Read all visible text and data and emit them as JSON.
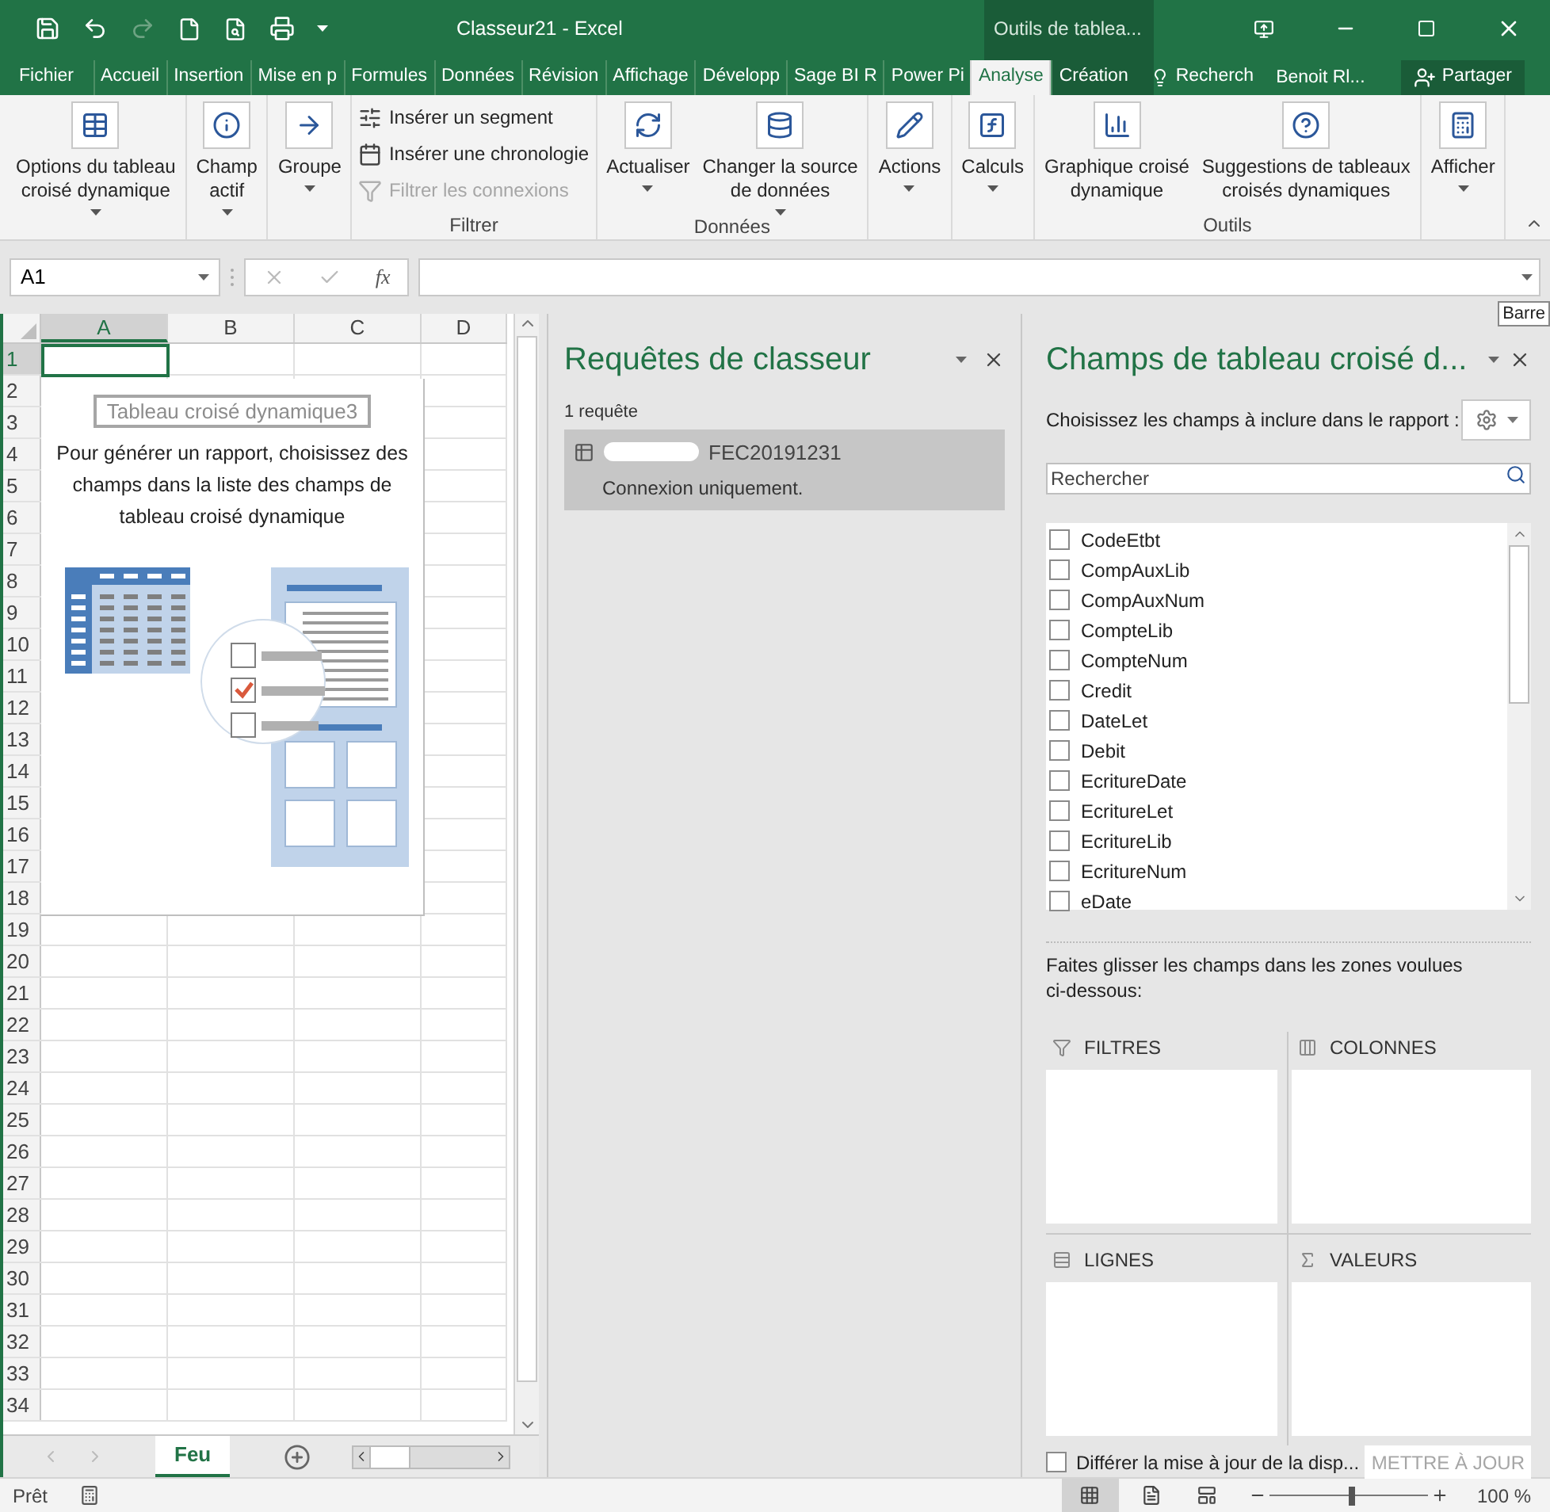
{
  "window": {
    "title": "Classeur21 - Excel",
    "contextual_tab_group": "Outils de tablea..."
  },
  "ribbon_tabs": [
    {
      "label": "Fichier",
      "selected": false
    },
    {
      "label": "Accueil",
      "selected": false
    },
    {
      "label": "Insertion",
      "selected": false
    },
    {
      "label": "Mise en p",
      "selected": false
    },
    {
      "label": "Formules",
      "selected": false
    },
    {
      "label": "Données",
      "selected": false
    },
    {
      "label": "Révision",
      "selected": false
    },
    {
      "label": "Affichage",
      "selected": false
    },
    {
      "label": "Développ",
      "selected": false
    },
    {
      "label": "Sage BI R",
      "selected": false
    },
    {
      "label": "Power Pi",
      "selected": false
    },
    {
      "label": "Analyse",
      "selected": true
    },
    {
      "label": "Création",
      "selected": false
    }
  ],
  "tell_me": "Recherch",
  "user": "Benoit Rl...",
  "share_button": "Partager",
  "ribbon_groups": [
    {
      "buttons": [
        {
          "kind": "large",
          "label": "Options du tableau\ncroisé dynamique",
          "dropdown": true,
          "disabled": false
        }
      ]
    },
    {
      "buttons": [
        {
          "kind": "large",
          "label": "Champ\nactif",
          "dropdown": true,
          "disabled": false
        }
      ]
    },
    {
      "buttons": [
        {
          "kind": "large",
          "label": "Groupe",
          "dropdown": true,
          "disabled": false
        }
      ]
    },
    {
      "label": "Filtrer",
      "buttons": [
        {
          "kind": "small",
          "label": "Insérer un segment",
          "dropdown": false,
          "disabled": false
        },
        {
          "kind": "small",
          "label": "Insérer une chronologie",
          "dropdown": false,
          "disabled": false
        },
        {
          "kind": "small",
          "label": "Filtrer les connexions",
          "dropdown": false,
          "disabled": true
        }
      ]
    },
    {
      "label": "Données",
      "buttons": [
        {
          "kind": "large",
          "label": "Actualiser",
          "dropdown": true,
          "disabled": false
        },
        {
          "kind": "large",
          "label": "Changer la source\nde données",
          "dropdown": true,
          "disabled": false
        }
      ]
    },
    {
      "buttons": [
        {
          "kind": "large",
          "label": "Actions",
          "dropdown": true,
          "disabled": false
        }
      ]
    },
    {
      "buttons": [
        {
          "kind": "large",
          "label": "Calculs",
          "dropdown": true,
          "disabled": false
        }
      ]
    },
    {
      "label": "Outils",
      "buttons": [
        {
          "kind": "large",
          "label": "Graphique croisé\ndynamique",
          "dropdown": false,
          "disabled": false
        },
        {
          "kind": "large",
          "label": "Suggestions de tableaux\ncroisés dynamiques",
          "dropdown": false,
          "disabled": false
        }
      ]
    },
    {
      "buttons": [
        {
          "kind": "large",
          "label": "Afficher",
          "dropdown": true,
          "disabled": false
        }
      ]
    }
  ],
  "name_box": "A1",
  "function_button": "fx",
  "tooltip": "Barre",
  "sheet": {
    "columns": [
      {
        "label": "A",
        "selected": true
      },
      {
        "label": "B",
        "selected": false
      },
      {
        "label": "C",
        "selected": false
      },
      {
        "label": "D",
        "selected": false
      }
    ],
    "rows": [
      "1",
      "2",
      "3",
      "4",
      "5",
      "6",
      "7",
      "8",
      "9",
      "10",
      "11",
      "12",
      "13",
      "14",
      "15",
      "16",
      "17",
      "18",
      "19",
      "20",
      "21",
      "22",
      "23",
      "24",
      "25",
      "26",
      "27",
      "28",
      "29",
      "30",
      "31",
      "32",
      "33",
      "34"
    ],
    "pivot_placeholder": {
      "name": "Tableau croisé dynamique3",
      "instructions": "Pour générer un rapport, choisissez des champs dans la liste des champs de tableau croisé dynamique"
    }
  },
  "sheet_tabs": [
    {
      "label": "Feu",
      "selected": true
    }
  ],
  "queries_pane": {
    "title": "Requêtes de classeur",
    "count": "1 requête",
    "queries": [
      {
        "name": "FEC20191231",
        "status": "Connexion uniquement.",
        "selected": true
      }
    ]
  },
  "fields_pane": {
    "title": "Champs de tableau croisé d...",
    "prompt": "Choisissez les champs à inclure dans le rapport :",
    "search_placeholder": "Rechercher",
    "fields": [
      {
        "label": "CodeEtbt",
        "checked": false
      },
      {
        "label": "CompAuxLib",
        "checked": false
      },
      {
        "label": "CompAuxNum",
        "checked": false
      },
      {
        "label": "CompteLib",
        "checked": false
      },
      {
        "label": "CompteNum",
        "checked": false
      },
      {
        "label": "Credit",
        "checked": false
      },
      {
        "label": "DateLet",
        "checked": false
      },
      {
        "label": "Debit",
        "checked": false
      },
      {
        "label": "EcritureDate",
        "checked": false
      },
      {
        "label": "EcritureLet",
        "checked": false
      },
      {
        "label": "EcritureLib",
        "checked": false
      },
      {
        "label": "EcritureNum",
        "checked": false
      },
      {
        "label": "eDate",
        "checked": false
      }
    ],
    "drag_hint": "Faites glisser les champs dans les zones voulues ci-dessous:",
    "areas": [
      {
        "kind": "filters",
        "label": "FILTRES"
      },
      {
        "kind": "columns",
        "label": "COLONNES"
      },
      {
        "kind": "rows",
        "label": "LIGNES"
      },
      {
        "kind": "values",
        "label": "VALEURS"
      }
    ],
    "defer_update": {
      "label": "Différer la mise à jour de la disp...",
      "checked": false
    },
    "update_button": {
      "label": "METTRE À JOUR",
      "disabled": true
    }
  },
  "status_bar": {
    "status": "Prêt",
    "zoom": {
      "level": 0.52,
      "reading": "100 %"
    }
  }
}
